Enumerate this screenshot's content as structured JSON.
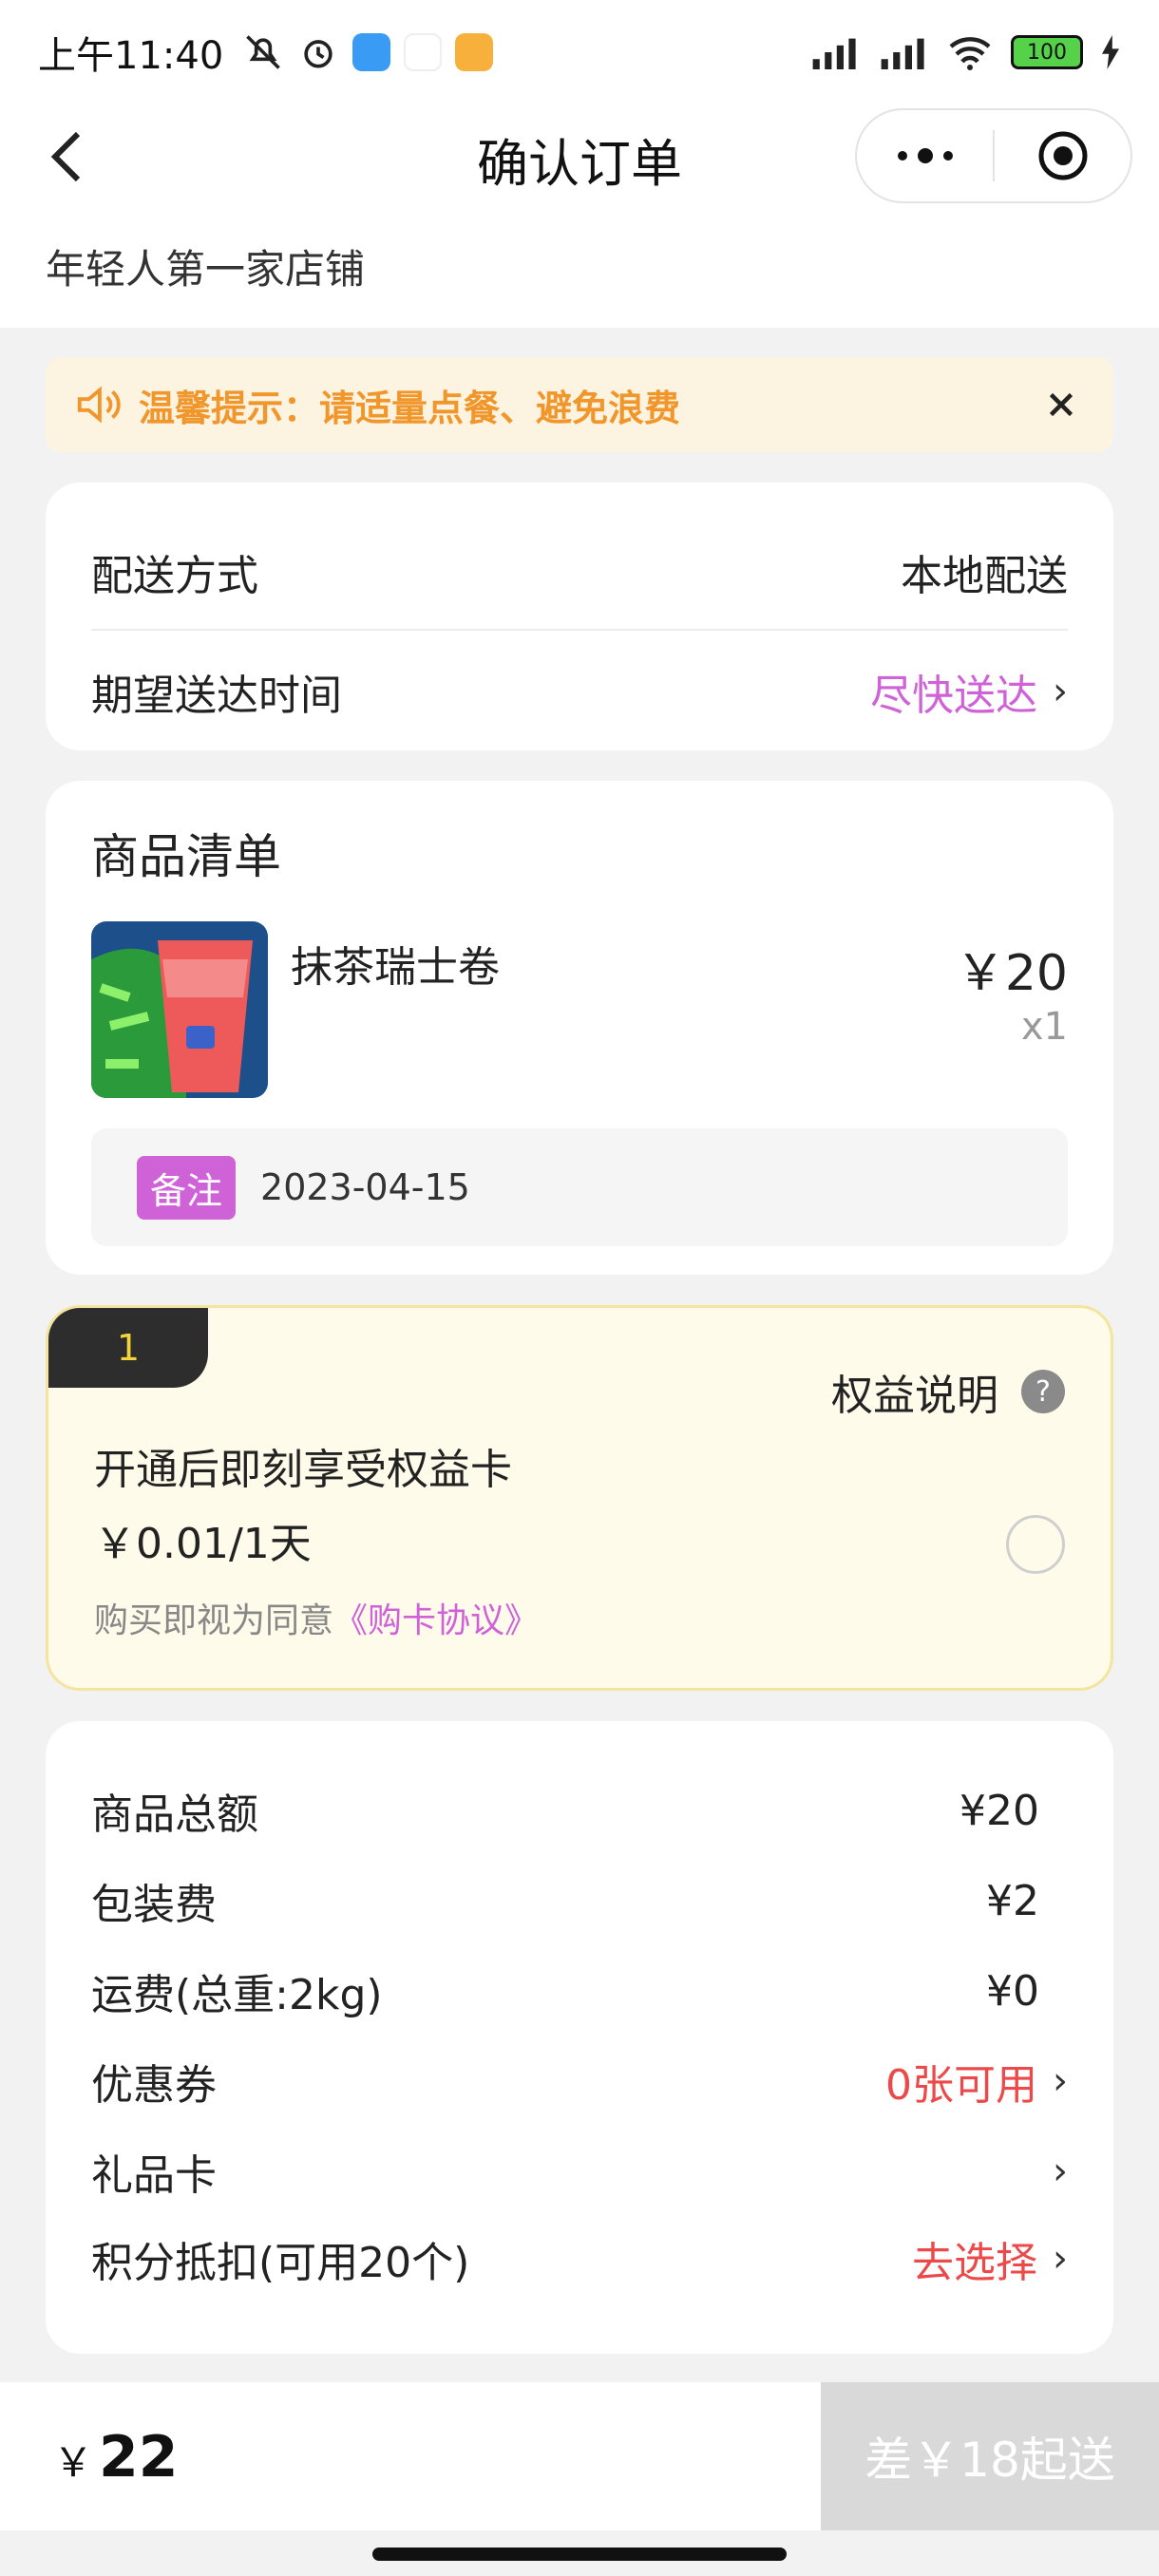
{
  "status": {
    "time": "上午11:40",
    "battery": "100"
  },
  "nav": {
    "title": "确认订单"
  },
  "store": {
    "name": "年轻人第一家店铺"
  },
  "notice": {
    "text": "温馨提示：请适量点餐、避免浪费"
  },
  "delivery": {
    "method_label": "配送方式",
    "method_value": "本地配送",
    "time_label": "期望送达时间",
    "time_value": "尽快送达"
  },
  "goods": {
    "title": "商品清单",
    "item_name": "抹茶瑞士卷",
    "item_price": "￥20",
    "item_qty": "x1",
    "remark_tag": "备注",
    "remark_text": "2023-04-15"
  },
  "benefit": {
    "badge": "1",
    "info_label": "权益说明",
    "help": "?",
    "title": "开通后即刻享受权益卡",
    "price": "￥0.01/1天",
    "agree_prefix": "购买即视为同意",
    "agree_link": "《购卡协议》"
  },
  "fees": {
    "items": [
      {
        "label": "商品总额",
        "value": "¥20"
      },
      {
        "label": "包装费",
        "value": "¥2"
      },
      {
        "label": "运费(总重:2kg)",
        "value": "¥0"
      },
      {
        "label": "优惠券",
        "value": "0张可用"
      },
      {
        "label": "礼品卡",
        "value": ""
      },
      {
        "label": "积分抵扣(可用20个)",
        "value": "去选择"
      }
    ]
  },
  "footer": {
    "currency": "￥",
    "total": "22",
    "submit": "差￥18起送"
  },
  "colors": {
    "accent": "#d062d8",
    "warning": "#f0962b",
    "red": "#ec4a4a"
  }
}
